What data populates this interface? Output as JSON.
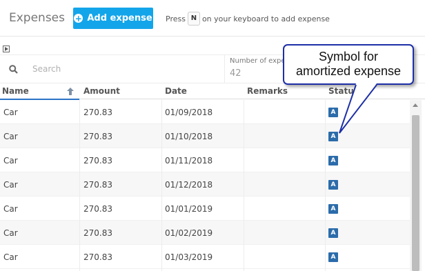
{
  "topbar": {
    "title": "Expenses",
    "add_button_label": "Add expense",
    "hint_prefix": "Press",
    "hint_key": "N",
    "hint_suffix": "on your keyboard to add expense"
  },
  "search": {
    "placeholder": "Search"
  },
  "stats": {
    "label": "Number of expe",
    "value": "42"
  },
  "columns": [
    "Name",
    "Amount",
    "Date",
    "Remarks",
    "Status"
  ],
  "sort": {
    "column": "Name",
    "direction": "ascending"
  },
  "rows": [
    {
      "name": "Car",
      "amount": "270.83",
      "date": "01/09/2018",
      "remarks": "",
      "status": "A"
    },
    {
      "name": "Car",
      "amount": "270.83",
      "date": "01/10/2018",
      "remarks": "",
      "status": "A"
    },
    {
      "name": "Car",
      "amount": "270.83",
      "date": "01/11/2018",
      "remarks": "",
      "status": "A"
    },
    {
      "name": "Car",
      "amount": "270.83",
      "date": "01/12/2018",
      "remarks": "",
      "status": "A"
    },
    {
      "name": "Car",
      "amount": "270.83",
      "date": "01/01/2019",
      "remarks": "",
      "status": "A"
    },
    {
      "name": "Car",
      "amount": "270.83",
      "date": "01/02/2019",
      "remarks": "",
      "status": "A"
    },
    {
      "name": "Car",
      "amount": "270.83",
      "date": "01/03/2019",
      "remarks": "",
      "status": "A"
    }
  ],
  "callout": {
    "line1": "Symbol for",
    "line2": "amortized expense"
  },
  "colors": {
    "accent": "#13a5ea",
    "badge": "#2c6cab",
    "callout_border": "#1d2fa7",
    "sort_underline": "#2a73c6"
  },
  "icons": {
    "add": "plus-circle-icon",
    "search": "search-icon",
    "sort": "arrow-up-icon",
    "panel_toggle": "panel-toggle-icon"
  }
}
